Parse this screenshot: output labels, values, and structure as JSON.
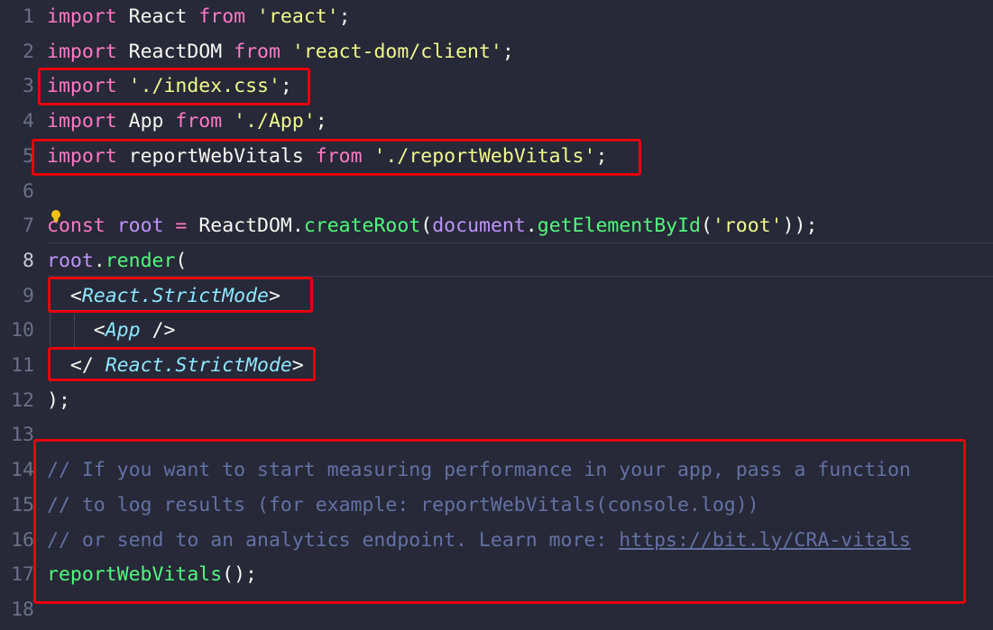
{
  "editor": {
    "active_line": "8",
    "lines": [
      {
        "no": "1",
        "t": [
          [
            "kw",
            "import"
          ],
          [
            "",
            "React"
          ],
          [
            "kw",
            "from"
          ],
          [
            "str",
            "'react'"
          ],
          [
            "",
            ";"
          ]
        ]
      },
      {
        "no": "2",
        "t": [
          [
            "kw",
            "import"
          ],
          [
            "",
            "ReactDOM"
          ],
          [
            "kw",
            "from"
          ],
          [
            "str",
            "'react-dom/client'"
          ],
          [
            "",
            ";"
          ]
        ]
      },
      {
        "no": "3",
        "t": [
          [
            "kw",
            "import"
          ],
          [
            "str",
            "'./index.css'"
          ],
          [
            "",
            ";"
          ]
        ]
      },
      {
        "no": "4",
        "t": [
          [
            "kw",
            "import"
          ],
          [
            "",
            "App"
          ],
          [
            "kw",
            "from"
          ],
          [
            "str",
            "'./App'"
          ],
          [
            "",
            ";"
          ]
        ]
      },
      {
        "no": "5",
        "t": [
          [
            "kw",
            "import"
          ],
          [
            "",
            "reportWebVitals"
          ],
          [
            "kw",
            "from"
          ],
          [
            "str",
            "'./reportWebVitals'"
          ],
          [
            "",
            ";"
          ]
        ]
      },
      {
        "no": "6",
        "t": []
      },
      {
        "no": "7",
        "t": [
          [
            "kw",
            "const"
          ],
          [
            "var",
            "root"
          ],
          [
            "op",
            "="
          ],
          [
            "",
            "ReactDOM."
          ],
          [
            "fn",
            "createRoot"
          ],
          [
            "",
            "("
          ],
          [
            "var",
            "document"
          ],
          [
            "",
            "."
          ],
          [
            "fn",
            "getElementById"
          ],
          [
            "",
            "("
          ],
          [
            "str",
            "'root'"
          ],
          [
            "",
            "));"
          ]
        ]
      },
      {
        "no": "8",
        "t": [
          [
            "var",
            "root"
          ],
          [
            "",
            "."
          ],
          [
            "fn",
            "render"
          ],
          [
            "",
            "("
          ]
        ]
      },
      {
        "no": "9",
        "t": [
          [
            "",
            "  <"
          ],
          [
            "tag",
            "React.StrictMode"
          ],
          [
            "",
            ">"
          ]
        ]
      },
      {
        "no": "10",
        "t": [
          [
            "",
            "    <"
          ],
          [
            "tag",
            "App"
          ],
          [
            "",
            " />"
          ]
        ]
      },
      {
        "no": "11",
        "t": [
          [
            "",
            "  </"
          ],
          [
            "tag",
            "React.StrictMode"
          ],
          [
            "",
            ">"
          ]
        ]
      },
      {
        "no": "12",
        "t": [
          [
            "",
            ");"
          ]
        ]
      },
      {
        "no": "13",
        "t": []
      },
      {
        "no": "14",
        "t": [
          [
            "cm",
            "// If you want to start measuring performance in your app, pass a function"
          ]
        ]
      },
      {
        "no": "15",
        "t": [
          [
            "cm",
            "// to log results (for example: reportWebVitals(console.log))"
          ]
        ]
      },
      {
        "no": "16",
        "t": [
          [
            "cm",
            "// or send to an analytics endpoint. Learn more: "
          ],
          [
            "link",
            "https://bit.ly/CRA-vitals"
          ]
        ]
      },
      {
        "no": "17",
        "t": [
          [
            "fn",
            "reportWebVitals"
          ],
          [
            "",
            "();"
          ]
        ]
      },
      {
        "no": "18",
        "t": []
      }
    ]
  },
  "colors": {
    "background": "#272838",
    "highlight_border": "#e8000b",
    "keyword": "#ff79c6",
    "string": "#f1fa8c",
    "function": "#50fa7b",
    "variable": "#bd93f9",
    "jsx_tag": "#8be9fd",
    "comment": "#6272a4",
    "lightbulb": "#f1c40f"
  },
  "icons": {
    "gutter_hint": "lightbulb-icon"
  }
}
